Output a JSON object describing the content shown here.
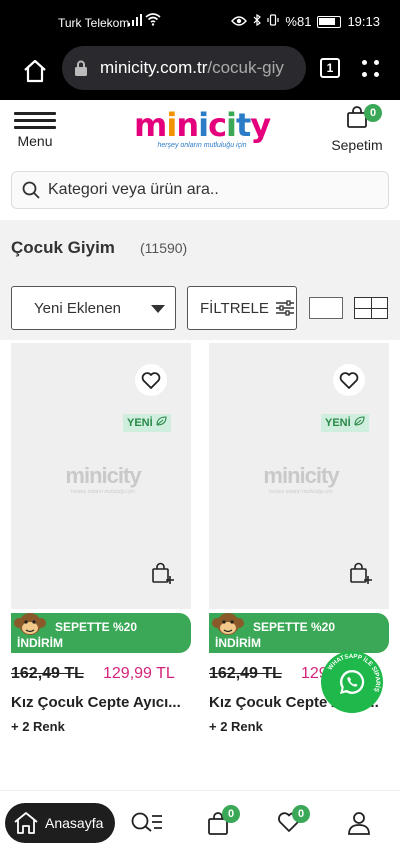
{
  "status_bar": {
    "carrier": "Turk Telekom",
    "battery": "%81",
    "time": "19:13"
  },
  "browser": {
    "url_main": "minicity.com.tr",
    "url_path": "/cocuk-giy",
    "tab_count": "1"
  },
  "header": {
    "menu_label": "Menu",
    "logo_text": "minicity",
    "logo_tagline": "herşey onların mutluluğu için",
    "cart_label": "Sepetim",
    "cart_count": "0"
  },
  "search": {
    "placeholder": "Kategori veya ürün ara.."
  },
  "category": {
    "title": "Çocuk Giyim",
    "count": "(11590)",
    "sort_selected": "Yeni Eklenen",
    "filter_label": "FİLTRELE"
  },
  "products": [
    {
      "badge": "YENİ",
      "placeholder_logo": "minicity",
      "placeholder_tagline": "herşey onların mutluluğu için",
      "promo_line1": "SEPETTE %20",
      "promo_line2": "İNDİRİM",
      "old_price": "162,49 TL",
      "new_price": "129,99 TL",
      "name": "Kız Çocuk Cepte Ayıcı...",
      "colors": "+ 2 Renk"
    },
    {
      "badge": "YENİ",
      "placeholder_logo": "minicity",
      "placeholder_tagline": "herşey onların mutluluğu için",
      "promo_line1": "SEPETTE %20",
      "promo_line2": "İNDİRİM",
      "old_price": "162,49 TL",
      "new_price": "129,99 TL",
      "name": "Kız Çocuk Cepte Ayıcı...",
      "colors": "+ 2 Renk"
    }
  ],
  "whatsapp": {
    "label": "WHATSAPP İLE SİPARİŞ"
  },
  "bottom_nav": {
    "home_label": "Anasayfa",
    "cart_count": "0",
    "favorites_count": "0"
  },
  "colors": {
    "accent_green": "#3aa856",
    "price_pink": "#d4247a",
    "whatsapp_green": "#1fb84b"
  }
}
